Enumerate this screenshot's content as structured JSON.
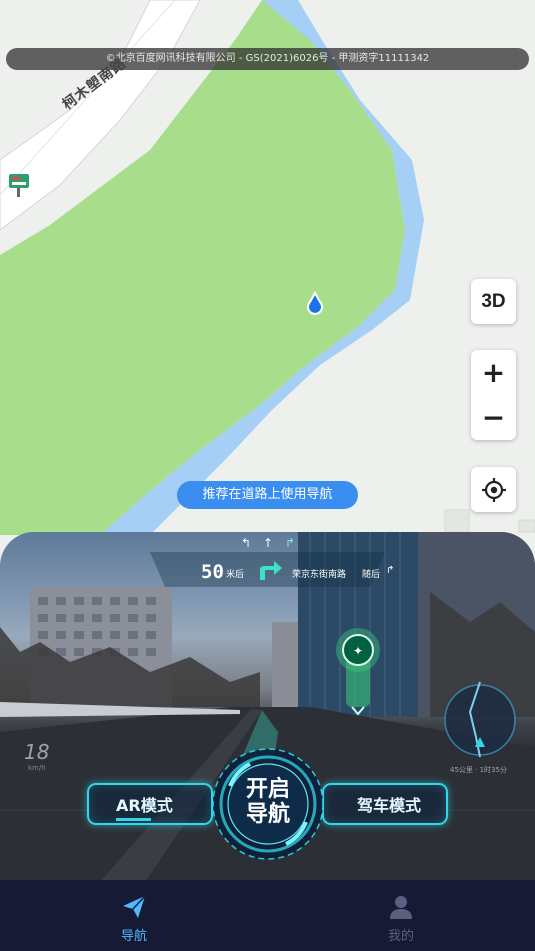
{
  "map": {
    "copyright": "©北京百度网讯科技有限公司 - GS(2021)6026号 - 甲测资字11111342",
    "road_label": "柯木塱南路",
    "poi_icon": "bus-stop-icon",
    "location_icon": "location-dot-icon",
    "btn_3d": "3D",
    "zoom_in": "+",
    "zoom_out": "−",
    "locate_icon": "crosshair-icon",
    "hint": "推荐在道路上使用导航",
    "colors": {
      "park": "#a7dd8b",
      "water": "#a5cff5",
      "road": "#ffffff",
      "ground": "#eef0ee",
      "accent": "#3a8ef0"
    }
  },
  "ar": {
    "lane_arrows": [
      "↰",
      "↑",
      "↱"
    ],
    "distance": "50",
    "distance_unit": "米后",
    "road_name": "荣京东街南路",
    "then_label": "随后",
    "then_icon": "↱",
    "speed": "18",
    "speed_unit": "km/h",
    "eta": "45公里 · 1时35分",
    "poi_icon": "starbucks-icon",
    "mode_ar": "AR模式",
    "mode_drive": "驾车模式",
    "start_nav": [
      "开启",
      "导航"
    ],
    "colors": {
      "neon": "#2fd7e8",
      "turn_arrow": "#3ee0c8"
    }
  },
  "tabs": [
    {
      "label": "导航",
      "icon": "paper-plane-icon",
      "active": true,
      "color": "#4fb8ff"
    },
    {
      "label": "我的",
      "icon": "user-icon",
      "active": false,
      "color": "#5a6080"
    }
  ]
}
